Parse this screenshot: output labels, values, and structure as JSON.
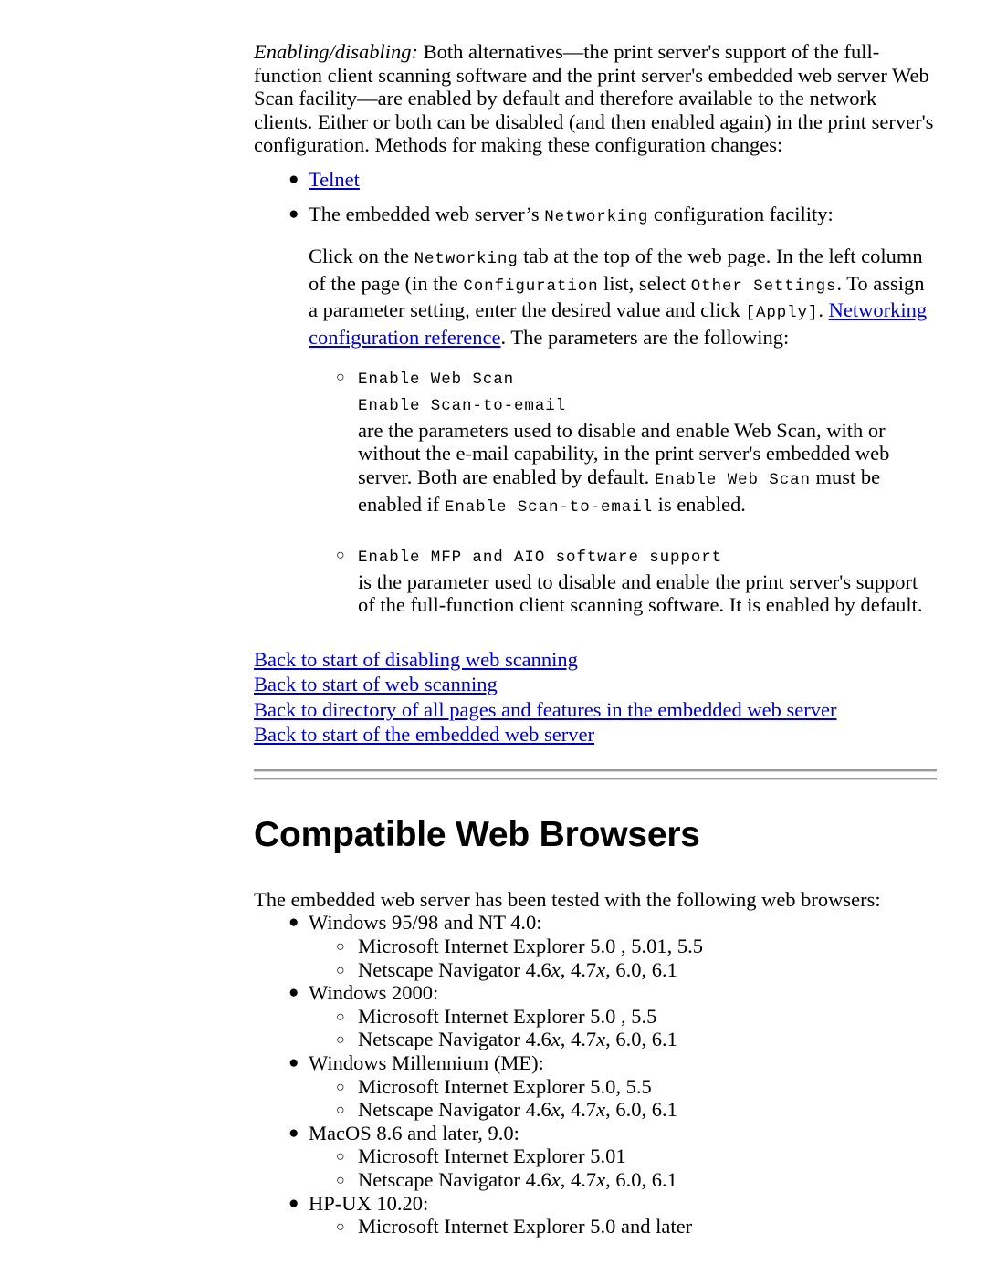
{
  "document": {
    "section_heading": "Compatible Web Browsers"
  },
  "enabling": {
    "lead_italic": "Enabling/disabling:",
    "paragraph": " Both alternatives—the print server's support of the full-function client scanning software and the print server's embedded web server Web Scan facility—are enabled by default and therefore available to the network clients. Either or both can be disabled (and then enabled again) in the print server's configuration. Methods for making these configuration changes:"
  },
  "methods": {
    "telnet_link": "Telnet",
    "embedded_bullet": {
      "text_before": "The embedded web server’s ",
      "code": "Networking",
      "text_after": " configuration facility:"
    },
    "instructions": {
      "p1": "Click on the ",
      "code1": "Networking",
      "p2": " tab at the top of the web page. In the left column of the page (in the ",
      "code2": "Configuration",
      "p3": " list, select ",
      "code3": "Other Settings",
      "p4": ". To assign a parameter setting, enter the desired value and click ",
      "code4": "[Apply]",
      "p5": ". ",
      "link": "Networking configuration reference",
      "p6": ". The parameters are the following:"
    }
  },
  "parameters": [
    {
      "code_lines": [
        "Enable Web Scan",
        "Enable Scan-to-email"
      ],
      "desc_1": "are the parameters used to disable and enable Web Scan, with or without the e-mail capability, in the print server's embedded web server. Both are enabled by default. ",
      "desc_code_1": "Enable Web Scan",
      "desc_2": " must be enabled if ",
      "desc_code_2": "Enable Scan-to-email",
      "desc_3": " is enabled."
    },
    {
      "code_lines": [
        "Enable MFP and AIO software support"
      ],
      "desc_1": "is the parameter used to disable and enable the print server's support of the full-function client scanning software. It is enabled by default.",
      "desc_code_1": "",
      "desc_2": "",
      "desc_code_2": "",
      "desc_3": ""
    }
  ],
  "back_links": [
    "Back to start of disabling web scanning",
    "Back to start of web scanning",
    "Back to directory of all pages and features in the embedded web server",
    "Back to start of the embedded web server"
  ],
  "browsers": {
    "intro": "The embedded web server has been tested with the following web browsers:",
    "platforms": [
      {
        "name": "Windows 95/98 and NT 4.0:",
        "items": [
          {
            "pre": "Microsoft Internet Explorer 5.0 , 5.01, 5.5",
            "versions": ""
          },
          {
            "pre": "Netscape Navigator 4.6",
            "ital1": "x",
            "mid1": ", 4.7",
            "ital2": "x",
            "post": ", 6.0, 6.1"
          }
        ]
      },
      {
        "name": "Windows 2000:",
        "items": [
          {
            "pre": "Microsoft Internet Explorer 5.0 , 5.5",
            "versions": ""
          },
          {
            "pre": "Netscape Navigator 4.6",
            "ital1": "x",
            "mid1": ", 4.7",
            "ital2": "x",
            "post": ", 6.0, 6.1"
          }
        ]
      },
      {
        "name": "Windows Millennium (ME):",
        "items": [
          {
            "pre": "Microsoft Internet Explorer 5.0, 5.5",
            "versions": ""
          },
          {
            "pre": "Netscape Navigator 4.6",
            "ital1": "x",
            "mid1": ", 4.7",
            "ital2": "x",
            "post": ", 6.0, 6.1"
          }
        ]
      },
      {
        "name": "MacOS 8.6 and later, 9.0:",
        "items": [
          {
            "pre": "Microsoft Internet Explorer 5.01",
            "versions": ""
          },
          {
            "pre": "Netscape Navigator 4.6",
            "ital1": "x",
            "mid1": ", 4.7",
            "ital2": "x",
            "post": ", 6.0, 6.1"
          }
        ]
      },
      {
        "name": "HP-UX 10.20:",
        "items": [
          {
            "pre": "Microsoft Internet Explorer 5.0 and later",
            "versions": ""
          }
        ]
      }
    ]
  },
  "glyphs": {
    "filled_bullet": "●",
    "hollow_bullet": "○"
  },
  "colors": {
    "link": "#0000cc",
    "text": "#000000",
    "rule": "#9a9a9a"
  }
}
